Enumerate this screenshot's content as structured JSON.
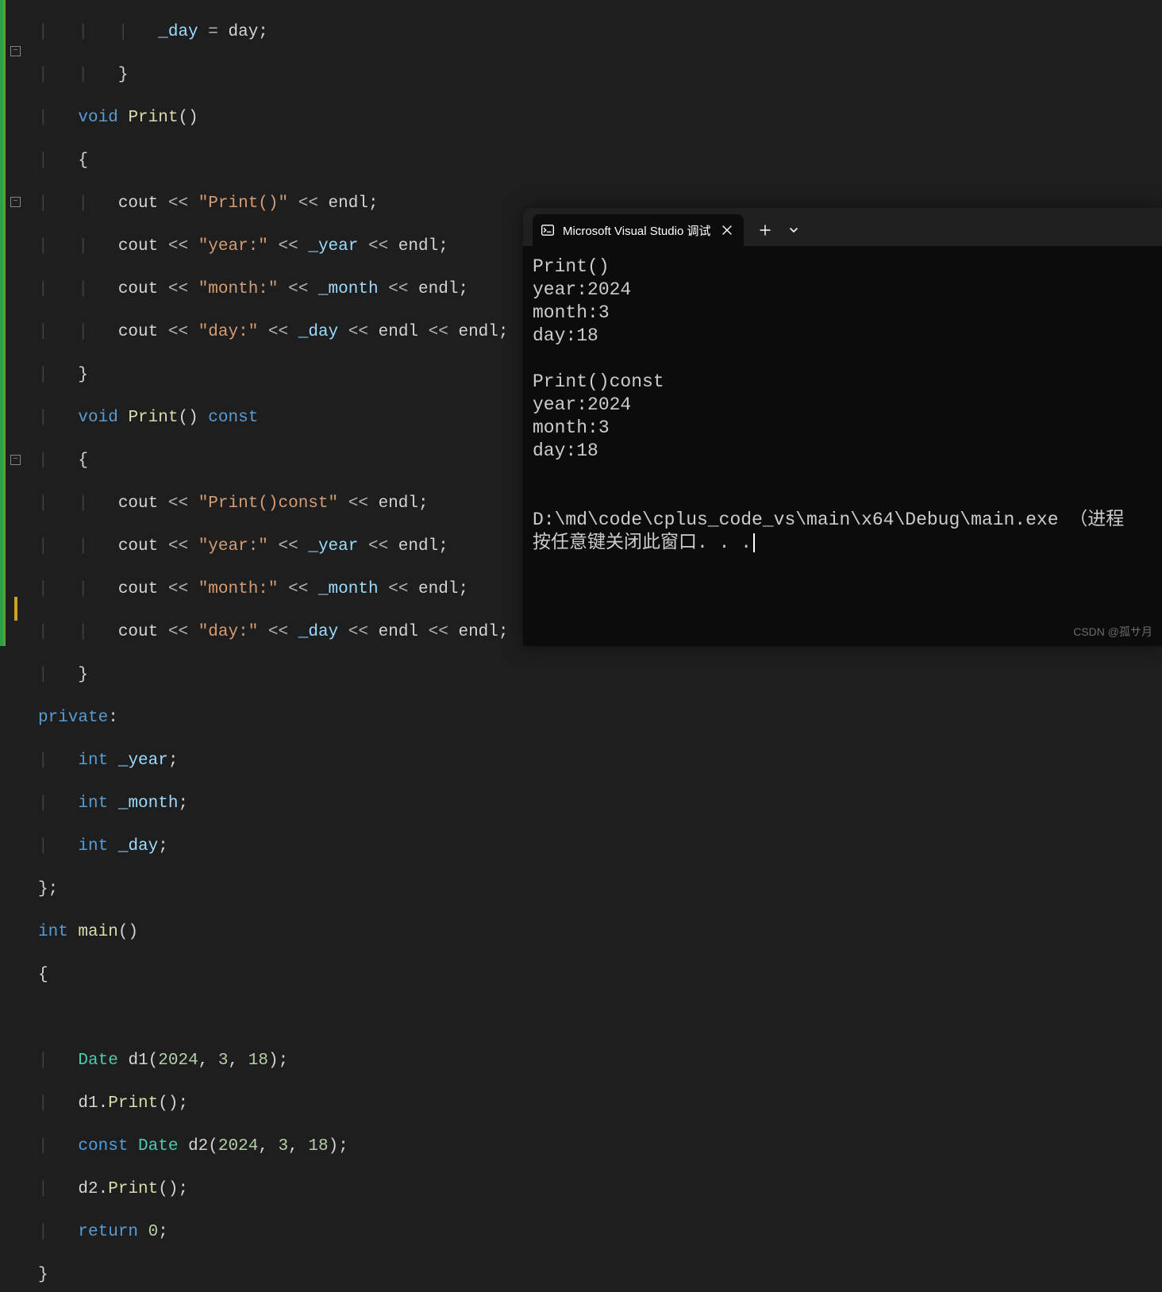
{
  "code": {
    "l1": "            _day = day;",
    "l2": "        }",
    "l3a": "        void ",
    "l3b": "Print",
    "l3c": "()",
    "l4": "        {",
    "l5a": "            cout ",
    "l5op": "<<",
    "l5s": " \"Print()\" ",
    "l5e": " endl",
    "l5p": ";",
    "l6s": " \"year:\" ",
    "l6v": " _year ",
    "l7s": " \"month:\" ",
    "l7v": " _month ",
    "l8s": " \"day:\" ",
    "l8v": " _day ",
    "l9": "        }",
    "l10c": " const",
    "l13s": " \"Print()const\" ",
    "l18": "private",
    "l18c": ":",
    "l19t": "        int ",
    "l19v": "_year",
    "l19p": ";",
    "l20v": "_month",
    "l21v": "_day",
    "l22": "};",
    "l23a": "int ",
    "l23b": "main",
    "l23c": "()",
    "l24": "{",
    "l26a": "        Date ",
    "l26b": "d1",
    "l26c": "(",
    "l26y": "2024",
    "l26cm": ", ",
    "l26m": "3",
    "l26d": "18",
    "l26e": ");",
    "l27a": "        d1",
    "l27b": ".",
    "l27c": "Print",
    "l27d": "();",
    "l28a": "        const ",
    "l28b": "Date ",
    "l28c": "d2",
    "l28d": "(",
    "l30a": "        return ",
    "l30b": "0",
    "l30c": ";",
    "l31": "}"
  },
  "terminal": {
    "tab_title": "Microsoft Visual Studio 调试",
    "output": "Print()\nyear:2024\nmonth:3\nday:18\n\nPrint()const\nyear:2024\nmonth:3\nday:18\n\n\nD:\\md\\code\\cplus_code_vs\\main\\x64\\Debug\\main.exe （进程\n按任意键关闭此窗口. . ."
  },
  "watermark": "CSDN @孤サ月"
}
